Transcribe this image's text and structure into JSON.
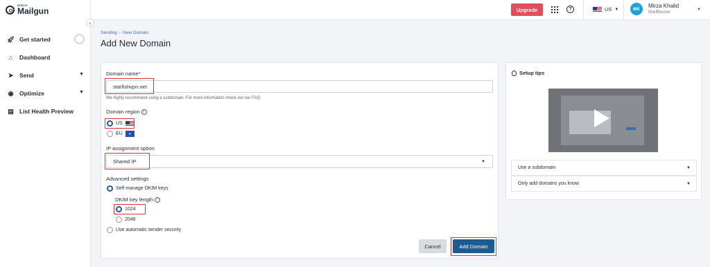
{
  "brand": {
    "sinch": "SINCH",
    "name": "Mailgun"
  },
  "sidebar": {
    "collapse": "‹",
    "items": [
      {
        "label": "Get started"
      },
      {
        "label": "Dashboard"
      },
      {
        "label": "Send"
      },
      {
        "label": "Optimize"
      },
      {
        "label": "List Health Preview"
      }
    ]
  },
  "topbar": {
    "upgrade": "Upgrade",
    "help": "?",
    "region": "US",
    "user": {
      "initials": "MK",
      "name": "Mirza Khalid",
      "org": "MailBluster"
    }
  },
  "breadcrumb": {
    "parent": "Sending",
    "current": "New Domain"
  },
  "page_title": "Add New Domain",
  "form": {
    "domain_label": "Domain name*",
    "domain_value": "starfishvpn.net",
    "hint_text": "We highly recommend using a subdomain. For more information check out our",
    "hint_link": "FAQ",
    "hint_end": ".",
    "region_label": "Domain region",
    "region_us": "US",
    "region_eu": "EU",
    "ip_label": "IP assignment option",
    "ip_value": "Shared IP",
    "advanced_label": "Advanced settings",
    "self_manage": "Self-manage DKIM keys",
    "dkim_label": "DKIM key length",
    "dkim_1024": "1024",
    "dkim_2048": "2048",
    "auto_security": "Use automatic sender security",
    "cancel": "Cancel",
    "add": "Add Domain"
  },
  "tips": {
    "title": "Setup tips",
    "items": [
      {
        "label": "Use a subdomain"
      },
      {
        "label": "Only add domains you know"
      }
    ]
  },
  "colors": {
    "primary": "#1d5b93",
    "upgrade": "#e04f5a",
    "highlight": "#e0303a",
    "avatar": "#1fa0e0"
  }
}
